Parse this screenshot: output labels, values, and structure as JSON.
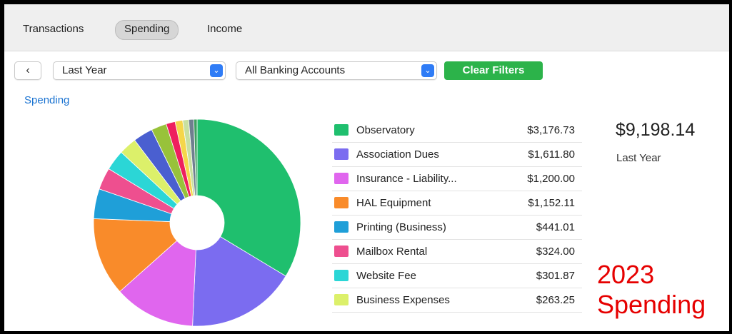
{
  "tabs": [
    {
      "label": "Transactions",
      "active": false
    },
    {
      "label": "Spending",
      "active": true
    },
    {
      "label": "Income",
      "active": false
    }
  ],
  "filters": {
    "back_icon": "chevron-left-icon",
    "period": "Last Year",
    "accounts": "All Banking Accounts",
    "clear_label": "Clear Filters",
    "clear_color": "#2cb34a",
    "select_accent": "#2f7cf6"
  },
  "section_title": "Spending",
  "summary": {
    "total": "$9,198.14",
    "period": "Last Year"
  },
  "chart_data": {
    "type": "pie",
    "style": "donut",
    "categories": [
      "Observatory",
      "Association Dues",
      "Insurance - Liability...",
      "HAL Equipment",
      "Printing (Business)",
      "Mailbox Rental",
      "Website Fee",
      "Business Expenses"
    ],
    "amounts": [
      "$3,176.73",
      "$1,611.80",
      "$1,200.00",
      "$1,152.11",
      "$441.01",
      "$324.00",
      "$301.87",
      "$263.25"
    ],
    "values": [
      3176.73,
      1611.8,
      1200.0,
      1152.11,
      441.01,
      324.0,
      301.87,
      263.25
    ],
    "colors": [
      "#1fbf6e",
      "#7b6cf0",
      "#e066ee",
      "#f98b2a",
      "#1f9fd8",
      "#ee4f8f",
      "#2bd6d6",
      "#dcf06a"
    ],
    "unlisted_values": [
      290,
      227,
      133,
      112,
      88,
      75,
      48
    ],
    "unlisted_colors": [
      "#4a5fd0",
      "#98c23a",
      "#ee1f5e",
      "#f5d64a",
      "#c8e0a0",
      "#6f7f8f",
      "#3fa060"
    ]
  },
  "annotation": {
    "year": "2023",
    "word": "Spending",
    "color": "#e60000"
  }
}
